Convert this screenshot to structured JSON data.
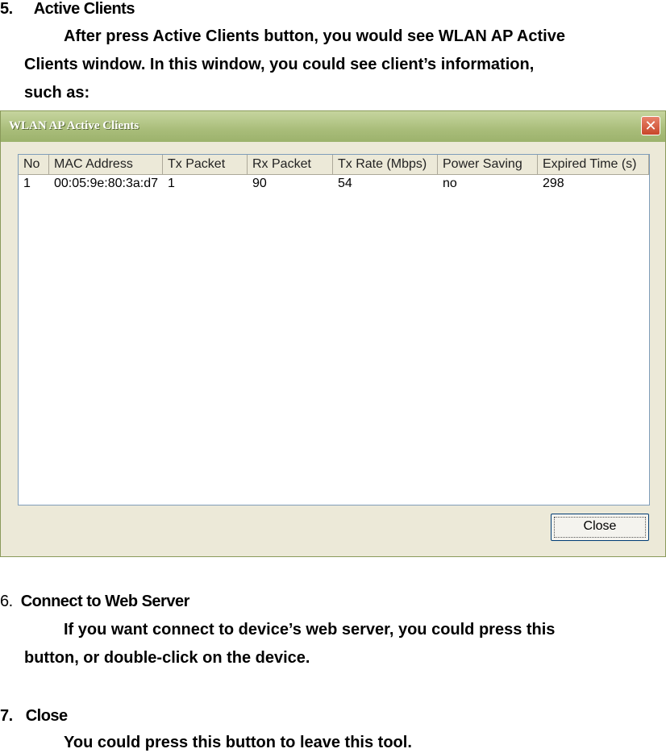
{
  "section5": {
    "number": "5.",
    "title": "Active Clients",
    "lines": [
      "After press Active Clients button, you would see WLAN AP Active",
      "Clients window. In this window, you could see client’s information,",
      "such as:"
    ]
  },
  "window": {
    "title": "WLAN AP Active Clients",
    "close_icon": "close-icon",
    "close_button": "Close",
    "columns": [
      "No",
      "MAC Address",
      "Tx Packet",
      "Rx Packet",
      "Tx Rate (Mbps)",
      "Power Saving",
      "Expired Time (s)"
    ],
    "rows": [
      [
        "1",
        "00:05:9e:80:3a:d7",
        "1",
        "90",
        "54",
        "no",
        "298"
      ]
    ]
  },
  "section6": {
    "number": "6.",
    "title": "Connect to Web Server",
    "lines": [
      "If you want connect to device’s web server, you could press this",
      "button, or double-click on the device."
    ]
  },
  "section7": {
    "number": "7.",
    "title": "Close",
    "lines": [
      "You could press this button to leave this tool."
    ]
  }
}
